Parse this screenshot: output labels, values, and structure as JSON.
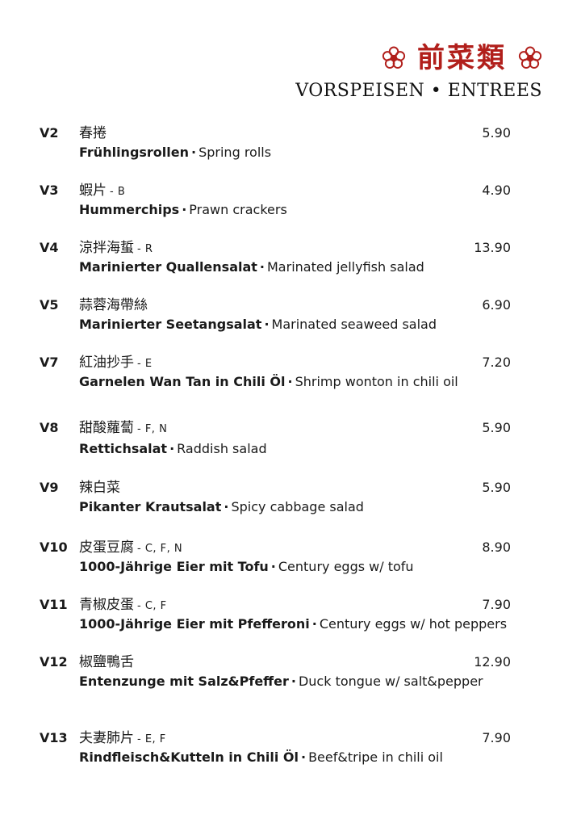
{
  "header": {
    "title_cn": "前菜類",
    "subtitle": "VORSPEISEN • ENTREES",
    "flower_color": "#b11f1b"
  },
  "items": [
    {
      "code": "V2",
      "cn": "春捲",
      "allergens": "",
      "price": "5.90",
      "de": "Frühlingsrollen",
      "en": "Spring rolls"
    },
    {
      "code": "V3",
      "cn": "蝦片",
      "allergens": "- B",
      "price": "4.90",
      "de": "Hummerchips",
      "en": "Prawn crackers"
    },
    {
      "code": "V4",
      "cn": "涼拌海蜇",
      "allergens": "- R",
      "price": "13.90",
      "de": "Marinierter Quallensalat",
      "en": "Marinated jellyfish salad"
    },
    {
      "code": "V5",
      "cn": "蒜蓉海帶絲",
      "allergens": "",
      "price": "6.90",
      "de": "Marinierter Seetangsalat",
      "en": "Marinated seaweed salad"
    },
    {
      "code": "V7",
      "cn": "紅油抄手",
      "allergens": "- E",
      "price": "7.20",
      "de": "Garnelen Wan Tan in Chili Öl",
      "en": "Shrimp wonton in chili oil"
    },
    {
      "code": "V8",
      "cn": "甜酸蘿蔔",
      "allergens": "- F, N",
      "price": "5.90",
      "de": "Rettichsalat",
      "en": "Raddish salad"
    },
    {
      "code": "V9",
      "cn": "辣白菜",
      "allergens": "",
      "price": "5.90",
      "de": "Pikanter Krautsalat",
      "en": "Spicy cabbage salad"
    },
    {
      "code": "V10",
      "cn": "皮蛋豆腐",
      "allergens": "- C, F, N",
      "price": "8.90",
      "de": "1000-Jährige Eier mit Tofu",
      "en": "Century eggs w/ tofu"
    },
    {
      "code": "V11",
      "cn": "青椒皮蛋",
      "allergens": "- C, F",
      "price": "7.90",
      "de": "1000-Jährige Eier mit Pfefferoni",
      "en": "Century eggs w/ hot peppers"
    },
    {
      "code": "V12",
      "cn": "椒鹽鴨舌",
      "allergens": "",
      "price": "12.90",
      "de": "Entenzunge mit Salz&Pfeffer",
      "en": "Duck tongue w/ salt&pepper"
    },
    {
      "code": "V13",
      "cn": "夫妻肺片",
      "allergens": "- E, F",
      "price": "7.90",
      "de": "Rindfleisch&Kutteln in Chili Öl",
      "en": "Beef&tripe in chili oil"
    }
  ]
}
